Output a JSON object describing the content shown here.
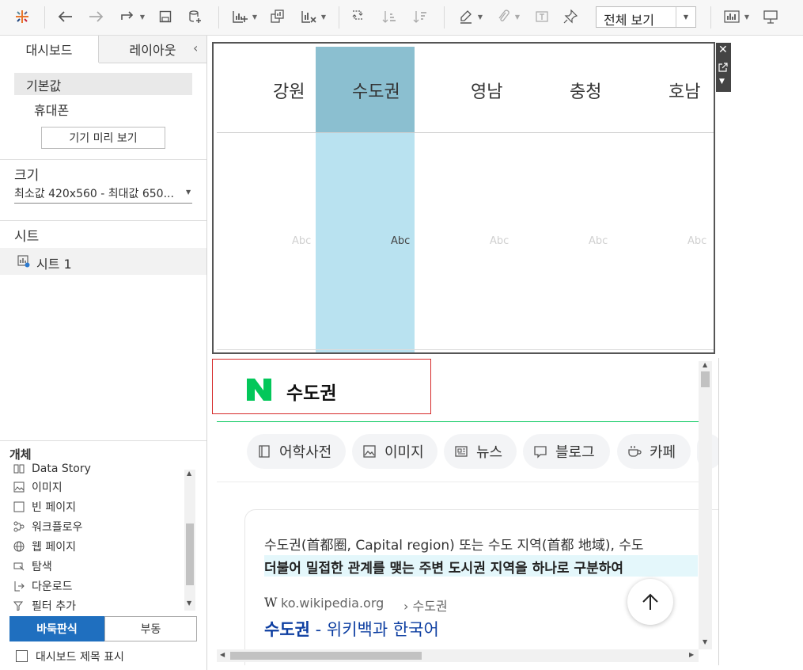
{
  "toolbar": {
    "view_select": {
      "value": "전체 보기"
    }
  },
  "left_panel": {
    "tabs": [
      "대시보드",
      "레이아웃"
    ],
    "device_options": [
      "기본값",
      "휴대폰"
    ],
    "device_preview_button": "기기 미리 보기",
    "size_title": "크기",
    "size_value": "최소값 420x560 - 최대값 650...",
    "sheets_title": "시트",
    "sheet_item": "시트 1",
    "objects_title": "개체",
    "objects": [
      "Data Story",
      "이미지",
      "빈 페이지",
      "워크플로우",
      "웹 페이지",
      "탐색",
      "다운로드",
      "필터 추가"
    ],
    "layout_buttons": [
      "바둑판식",
      "부동"
    ],
    "show_title_label": "대시보드 제목 표시"
  },
  "sheet": {
    "columns": [
      "강원",
      "수도권",
      "영남",
      "충청",
      "호남"
    ],
    "cell_text": "Abc",
    "selected_column": "수도권"
  },
  "web": {
    "search_query": "수도권",
    "chips": [
      "어학사전",
      "이미지",
      "뉴스",
      "블로그",
      "카페"
    ],
    "snippet_line1": "수도권(首都圈, Capital region) 또는 수도 지역(首都 地域), 수도",
    "snippet_line2": "더불어 밀접한 관계를 맺는 주변 도시권 지역을 하나로 구분하여",
    "source": "ko.wikipedia.org",
    "breadcrumb": "› 수도권",
    "result_title_bold": "수도권",
    "result_title_rest": " - 위키백과 한국어"
  },
  "colors": {
    "naver_green": "#03c75a",
    "selected_column_head": "#8bbfd0",
    "selected_column_body": "#b9e2f0",
    "tiled_button": "#1f6fbf",
    "link_blue": "#0d3ea1",
    "highlight_box": "#d62b2b"
  }
}
